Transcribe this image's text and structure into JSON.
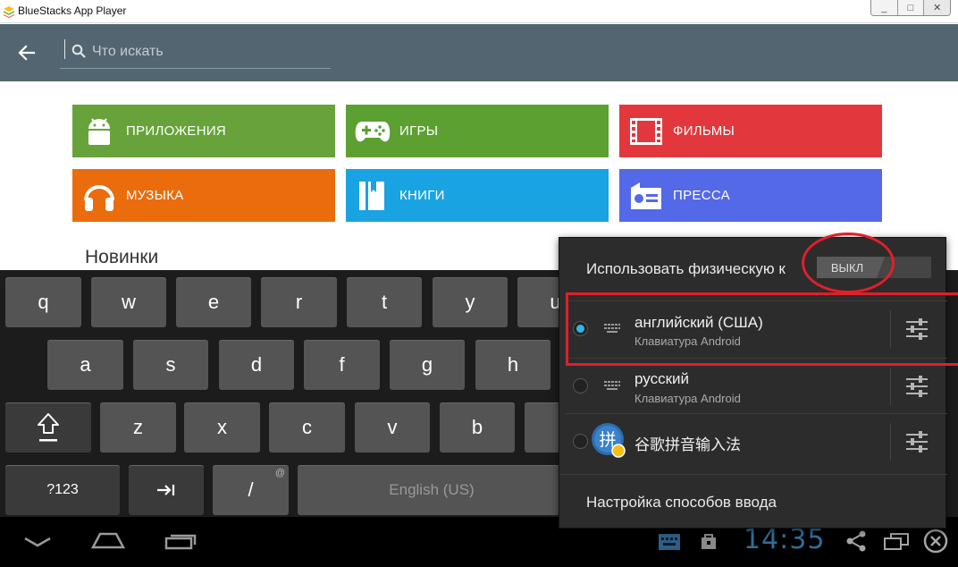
{
  "window": {
    "title": "BlueStacks App Player",
    "buttons": [
      "_",
      "□",
      "✕"
    ]
  },
  "search": {
    "placeholder": "Что искать"
  },
  "categories": [
    {
      "label": "ПРИЛОЖЕНИЯ",
      "color": "#67a33a",
      "icon": "android-icon"
    },
    {
      "label": "ИГРЫ",
      "color": "#5ca032",
      "icon": "gamepad-icon"
    },
    {
      "label": "ФИЛЬМЫ",
      "color": "#e2383d",
      "icon": "film-icon"
    },
    {
      "label": "МУЗЫКА",
      "color": "#ea6c0d",
      "icon": "headphones-icon"
    },
    {
      "label": "КНИГИ",
      "color": "#1aa3e2",
      "icon": "books-icon"
    },
    {
      "label": "ПРЕССА",
      "color": "#5369e8",
      "icon": "newspaper-icon"
    }
  ],
  "section": {
    "title": "Новинки"
  },
  "keyboard": {
    "row1": [
      "q",
      "w",
      "e",
      "r",
      "t",
      "y",
      "u"
    ],
    "row2": [
      "a",
      "s",
      "d",
      "f",
      "g",
      "h"
    ],
    "row3": [
      "z",
      "x",
      "c",
      "v",
      "b"
    ],
    "symbols_label": "?123",
    "slash_label": "/",
    "slash_sub": "@",
    "space_label": "English (US)"
  },
  "statusbar": {
    "time": "14:35"
  },
  "input_popup": {
    "header": "Использовать физическую к",
    "toggle_label": "ВЫКЛ",
    "methods": [
      {
        "name": "английский (США)",
        "sub": "Клавиатура Android",
        "selected": true
      },
      {
        "name": "русский",
        "sub": "Клавиатура Android",
        "selected": false
      },
      {
        "name": "谷歌拼音输入法",
        "sub": "",
        "selected": false
      }
    ],
    "footer": "Настройка способов ввода"
  },
  "colors": {
    "actionbar": "#536570",
    "accent": "#33b5e5",
    "annotation": "#e0202a"
  }
}
